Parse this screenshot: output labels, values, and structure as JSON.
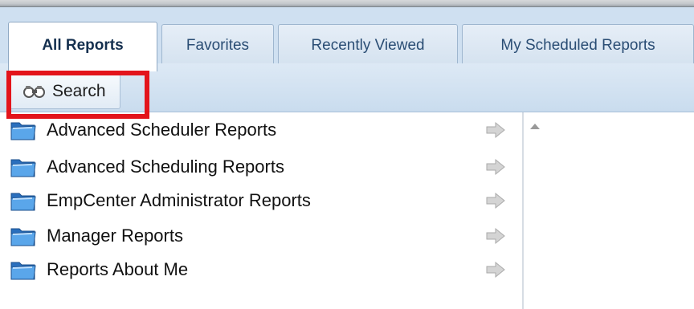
{
  "tabs": [
    {
      "label": "All Reports",
      "active": true
    },
    {
      "label": "Favorites",
      "active": false
    },
    {
      "label": "Recently Viewed",
      "active": false
    },
    {
      "label": "My Scheduled Reports",
      "active": false
    }
  ],
  "toolbar": {
    "search_label": "Search",
    "search_icon": "binoculars-icon"
  },
  "report_folders": [
    {
      "label": "Advanced Scheduler Reports"
    },
    {
      "label": "Advanced Scheduling Reports"
    },
    {
      "label": "EmpCenter Administrator Reports"
    },
    {
      "label": "Manager Reports"
    },
    {
      "label": "Reports About Me"
    }
  ],
  "colors": {
    "tab_bar": "#cfe0f1",
    "highlight": "#e3141b",
    "folder_blue": "#3a86d6",
    "arrow_gray": "#c8c8c8"
  }
}
